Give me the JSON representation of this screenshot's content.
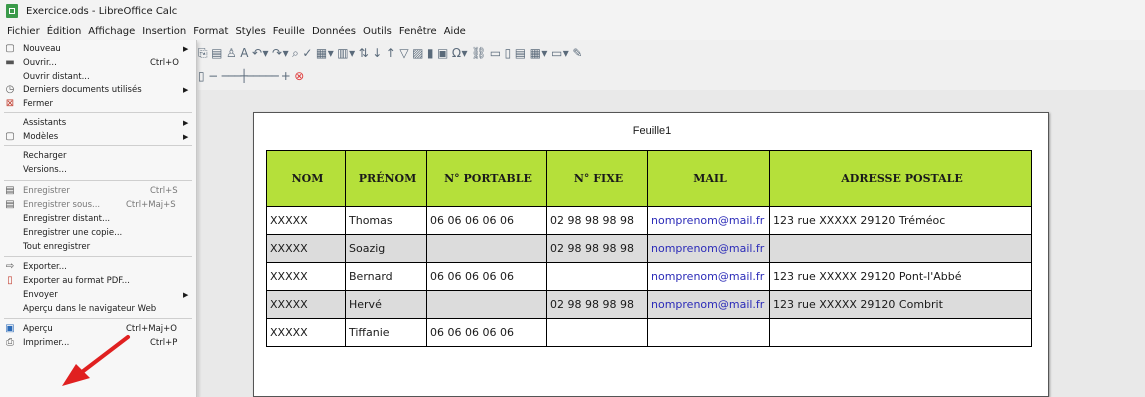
{
  "window": {
    "title": "Exercice.ods - LibreOffice Calc"
  },
  "menubar": [
    "Fichier",
    "Édition",
    "Affichage",
    "Insertion",
    "Format",
    "Styles",
    "Feuille",
    "Données",
    "Outils",
    "Fenêtre",
    "Aide"
  ],
  "file_menu": [
    {
      "label": "Nouveau",
      "icon": "new-document-icon",
      "arrow": true
    },
    {
      "label": "Ouvrir...",
      "shortcut": "Ctrl+O",
      "icon": "open-folder-icon"
    },
    {
      "label": "Ouvrir distant..."
    },
    {
      "label": "Derniers documents utilisés",
      "icon": "recent-clock-icon",
      "arrow": true
    },
    {
      "label": "Fermer",
      "icon": "close-document-icon"
    },
    {
      "label": "Assistants",
      "arrow": true
    },
    {
      "label": "Modèles",
      "icon": "templates-icon",
      "arrow": true
    },
    {
      "label": "Recharger"
    },
    {
      "label": "Versions..."
    },
    {
      "label": "Enregistrer",
      "shortcut": "Ctrl+S",
      "icon": "save-icon"
    },
    {
      "label": "Enregistrer sous...",
      "shortcut": "Ctrl+Maj+S",
      "icon": "save-as-icon"
    },
    {
      "label": "Enregistrer distant..."
    },
    {
      "label": "Enregistrer une copie..."
    },
    {
      "label": "Tout enregistrer"
    },
    {
      "label": "Exporter...",
      "icon": "export-icon"
    },
    {
      "label": "Exporter au format PDF...",
      "icon": "export-pdf-icon"
    },
    {
      "label": "Envoyer",
      "arrow": true
    },
    {
      "label": "Aperçu dans le navigateur Web"
    },
    {
      "label": "Aperçu",
      "shortcut": "Ctrl+Maj+O",
      "icon": "preview-icon"
    },
    {
      "label": "Imprimer...",
      "shortcut": "Ctrl+P",
      "icon": "printer-icon"
    }
  ],
  "sheet": {
    "name": "Feuille1",
    "headers": [
      "NOM",
      "PRÉNOM",
      "N° PORTABLE",
      "N° FIXE",
      "MAIL",
      "ADRESSE POSTALE"
    ],
    "rows": [
      [
        "XXXXX",
        "Thomas",
        "06 06 06 06 06",
        "02 98 98 98 98",
        "nomprenom@mail.fr",
        "123 rue XXXXX 29120 Tréméoc"
      ],
      [
        "XXXXX",
        "Soazig",
        "",
        "02 98 98 98 98",
        "nomprenom@mail.fr",
        ""
      ],
      [
        "XXXXX",
        "Bernard",
        "06 06 06 06 06",
        "",
        "nomprenom@mail.fr",
        "123 rue XXXXX 29120 Pont-l'Abbé"
      ],
      [
        "XXXXX",
        "Hervé",
        "",
        "02 98 98 98 98",
        "nomprenom@mail.fr",
        "123 rue XXXXX 29120 Combrit"
      ],
      [
        "XXXXX",
        "Tiffanie",
        "06 06 06 06 06",
        "",
        "",
        ""
      ]
    ]
  },
  "colors": {
    "header_fill": "#b5e03a",
    "alt_row": "#dcdcdc",
    "arrow": "#e02020",
    "mail": "#2b2bb8"
  }
}
